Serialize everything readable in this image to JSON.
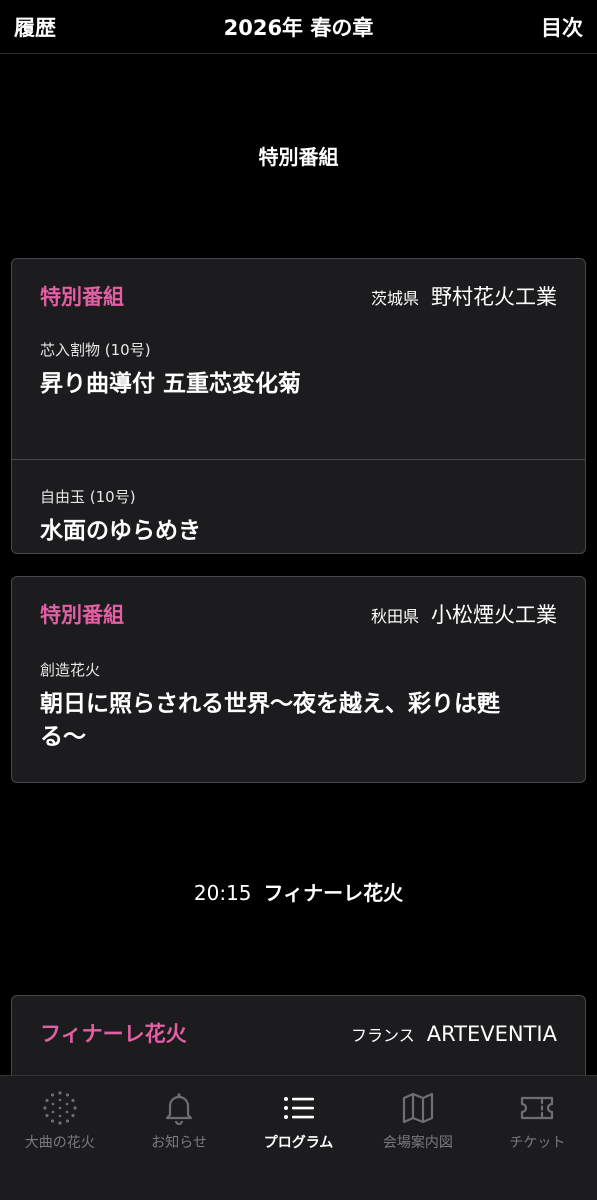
{
  "header": {
    "left": "履歴",
    "title": "2026年 春の章",
    "right": "目次"
  },
  "sections": [
    {
      "title": "特別番組",
      "cards": [
        {
          "category": "特別番組",
          "prefecture": "茨城県",
          "company": "野村花火工業",
          "items": [
            {
              "type": "芯入割物 (10号)",
              "title": "昇り曲導付 五重芯変化菊"
            },
            {
              "type": "自由玉 (10号)",
              "title": "水面のゆらめき"
            }
          ]
        },
        {
          "category": "特別番組",
          "prefecture": "秋田県",
          "company": "小松煙火工業",
          "items": [
            {
              "type": "創造花火",
              "title_line1": "朝日に照らされる世界〜夜を越え、彩りは甦",
              "title_line2": "る〜"
            }
          ]
        }
      ]
    },
    {
      "time": "20:15",
      "title": "フィナーレ花火",
      "cards": [
        {
          "category": "フィナーレ花火",
          "prefecture": "フランス",
          "company": "ARTEVENTIA"
        }
      ]
    }
  ],
  "tabs": [
    {
      "label": "大曲の花火",
      "icon": "fireworks-icon",
      "active": false
    },
    {
      "label": "お知らせ",
      "icon": "bell-icon",
      "active": false
    },
    {
      "label": "プログラム",
      "icon": "list-icon",
      "active": true
    },
    {
      "label": "会場案内図",
      "icon": "map-icon",
      "active": false
    },
    {
      "label": "チケット",
      "icon": "ticket-icon",
      "active": false
    }
  ],
  "colors": {
    "accent": "#e35fa4",
    "card_bg": "#1c1c1e",
    "card_border": "#48484a",
    "tab_inactive": "#7a7a7e"
  }
}
